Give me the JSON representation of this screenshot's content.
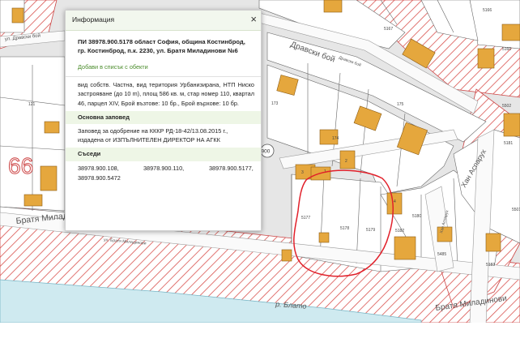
{
  "map": {
    "street_labels": {
      "dravski_boy_upper_left": "ул. Дравски бой",
      "dravski_boy": "Дравски бой",
      "dravski_boy_small": "Дравски бой",
      "bratya_miladinovi_left": "Братя Миладинови",
      "bratya_miladinovi_small": "ул. Братя Миладинови",
      "bratya_miladinovi_right": "Братя Миладинови",
      "han_asparuh": "Хан Аспарух",
      "han_asparuh_small": "Хан Аспарух",
      "river": "р. Блато"
    },
    "district_number": "66",
    "parcel_numbers": [
      "5177",
      "5178",
      "5179",
      "5180",
      "5182",
      "5183",
      "5160",
      "5167",
      "5166",
      "5181",
      "5485",
      "5501",
      "5502"
    ],
    "building_numbers": [
      "121",
      "173",
      "174",
      "175",
      "3",
      "1",
      "2",
      "4"
    ],
    "road_marker": "900"
  },
  "popup": {
    "title": "Информация",
    "close_symbol": "×",
    "parcel_heading": "ПИ 38978.900.5178 област София, община Костинброд, гр. Костинброд, п.к. 2230, ул. Братя Миладинови №6",
    "add_to_list_link": "Добави в списък с обекти",
    "description": "вид собств. Частна, вид територия Урбанизирана, НТП Ниско застрояване (до 10 m), площ 586 кв. м, стар номер 110, квартал 46, парцел XIV, Брой възтове: 10 бр., Брой върхове: 10 бр.",
    "order_section_title": "Основна заповед",
    "order_text": "Заповед за одобрение на КККР РД-18-42/13.08.2015 г., издадена от ИЗПЪЛНИТЕЛЕН ДИРЕКТОР НА АГКК",
    "neighbors_section_title": "Съседи",
    "neighbors": [
      "38978.900.108,",
      "38978.900.110,",
      "38978.900.5177,",
      "38978.900.5472"
    ]
  },
  "colors": {
    "building_fill": "#e5a73d",
    "building_stroke": "#8a5a13",
    "hatch_red": "#d9534f",
    "annotation_red": "#e1202a",
    "road_fill": "#fafafa",
    "map_background": "#e6e6e6",
    "popup_header": "#f2f7ee",
    "link_green": "#4b8c2c"
  }
}
